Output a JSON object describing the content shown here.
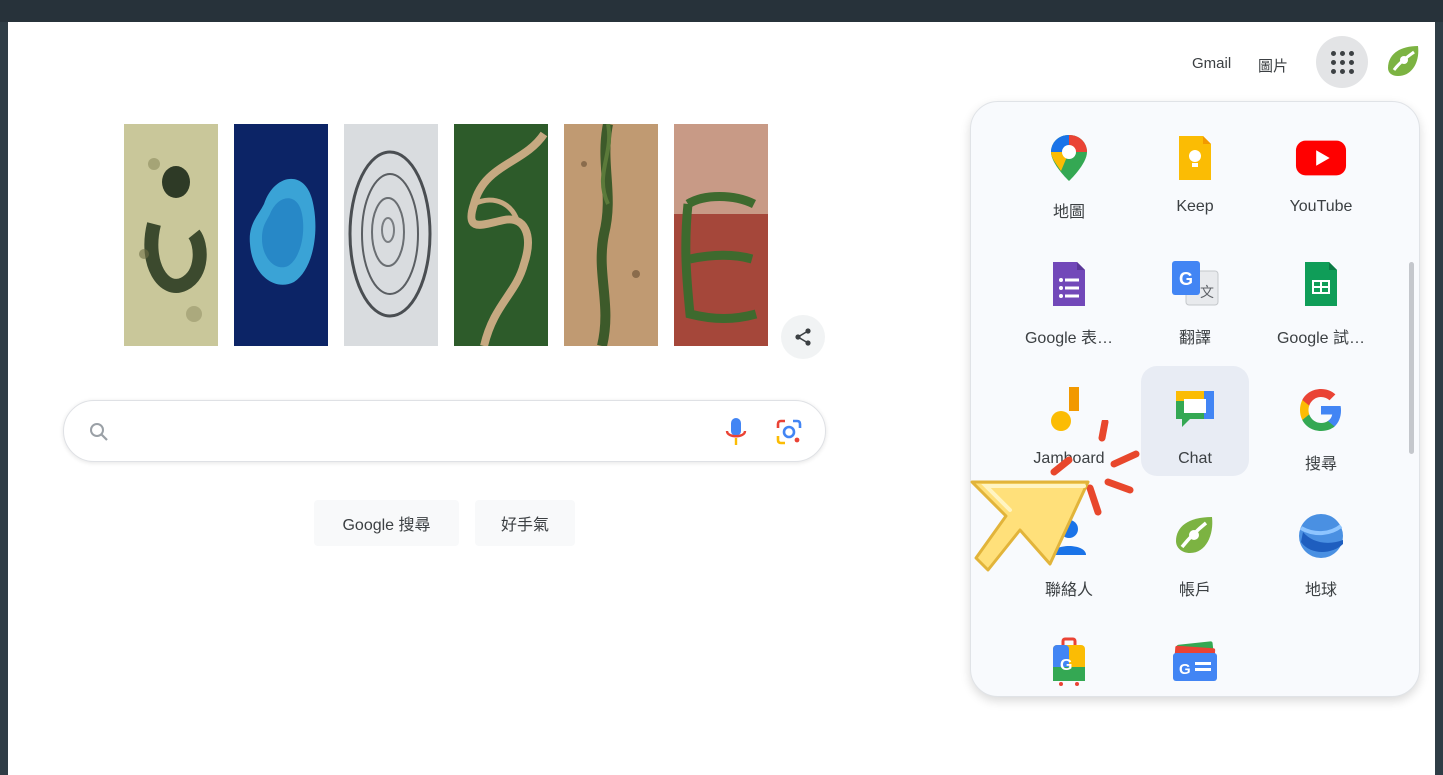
{
  "header": {
    "gmail": "Gmail",
    "images": "圖片",
    "apps_icon": "apps-grid-icon",
    "avatar_icon": "account-avatar-icon"
  },
  "doodle": {
    "tiles": [
      "doodle-letter-g",
      "doodle-letter-o",
      "doodle-letter-o-2",
      "doodle-letter-g-2",
      "doodle-letter-l",
      "doodle-letter-e"
    ],
    "share_icon": "share-icon"
  },
  "search": {
    "placeholder": "",
    "search_icon": "search-icon",
    "mic_icon": "microphone-icon",
    "lens_icon": "google-lens-icon",
    "search_button": "Google 搜尋",
    "lucky_button": "好手氣"
  },
  "apps": [
    {
      "label": "地圖",
      "icon": "maps-icon"
    },
    {
      "label": "Keep",
      "icon": "keep-icon"
    },
    {
      "label": "YouTube",
      "icon": "youtube-icon"
    },
    {
      "label": "Google 表…",
      "icon": "forms-icon"
    },
    {
      "label": "翻譯",
      "icon": "translate-icon"
    },
    {
      "label": "Google 試…",
      "icon": "sheets-icon"
    },
    {
      "label": "Jamboard",
      "icon": "jamboard-icon"
    },
    {
      "label": "Chat",
      "icon": "chat-icon"
    },
    {
      "label": "搜尋",
      "icon": "google-search-icon"
    },
    {
      "label": "聯絡人",
      "icon": "contacts-icon"
    },
    {
      "label": "帳戶",
      "icon": "account-icon"
    },
    {
      "label": "地球",
      "icon": "earth-icon"
    },
    {
      "label": "",
      "icon": "travel-icon"
    },
    {
      "label": "",
      "icon": "news-icon"
    }
  ],
  "colors": {
    "blue": "#4285f4",
    "red": "#ea4335",
    "yellow": "#fbbc04",
    "green": "#34a853",
    "panel_bg": "#f8fafd",
    "active_tile": "#e8ecf4"
  },
  "pointer": "click-pointer-icon"
}
